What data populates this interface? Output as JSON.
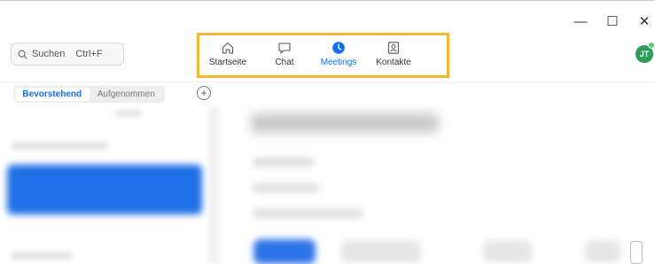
{
  "window": {
    "minimize_label": "—",
    "maximize_label": "☐",
    "close_label": "✕"
  },
  "search": {
    "label": "Suchen",
    "shortcut": "Ctrl+F"
  },
  "nav": [
    {
      "label": "Startseite",
      "icon": "home-icon",
      "active": false
    },
    {
      "label": "Chat",
      "icon": "chat-bubble-icon",
      "active": false
    },
    {
      "label": "Meetings",
      "icon": "clock-icon",
      "active": true
    },
    {
      "label": "Kontakte",
      "icon": "contact-card-icon",
      "active": false
    }
  ],
  "avatar": {
    "initials": "JT",
    "status_color": "#4fd16b"
  },
  "tabs": [
    {
      "label": "Bevorstehend",
      "active": true
    },
    {
      "label": "Aufgenommen",
      "active": false
    }
  ],
  "add_button_label": "+",
  "colors": {
    "accent": "#0e71eb",
    "highlight_border": "#f2b833",
    "avatar": "#2f9c5a"
  }
}
